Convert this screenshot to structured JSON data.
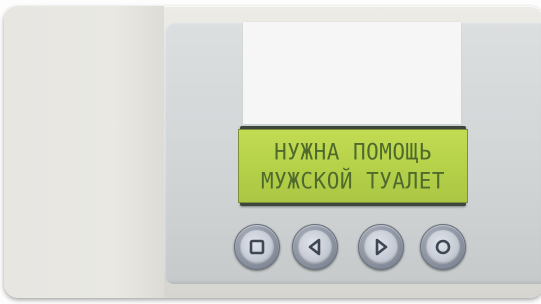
{
  "display": {
    "line1": "НУЖНА ПОМОЩЬ",
    "line2": "МУЖСКОЙ ТУАЛЕТ"
  },
  "buttons": [
    {
      "icon": "stop-square-icon"
    },
    {
      "icon": "arrow-left-icon"
    },
    {
      "icon": "arrow-right-icon"
    },
    {
      "icon": "circle-ok-icon"
    }
  ],
  "colors": {
    "lcd_background": "#b6d24a",
    "lcd_text": "#4f6a2c",
    "device_body": "#e2e1db",
    "button": "#8d94a2"
  }
}
